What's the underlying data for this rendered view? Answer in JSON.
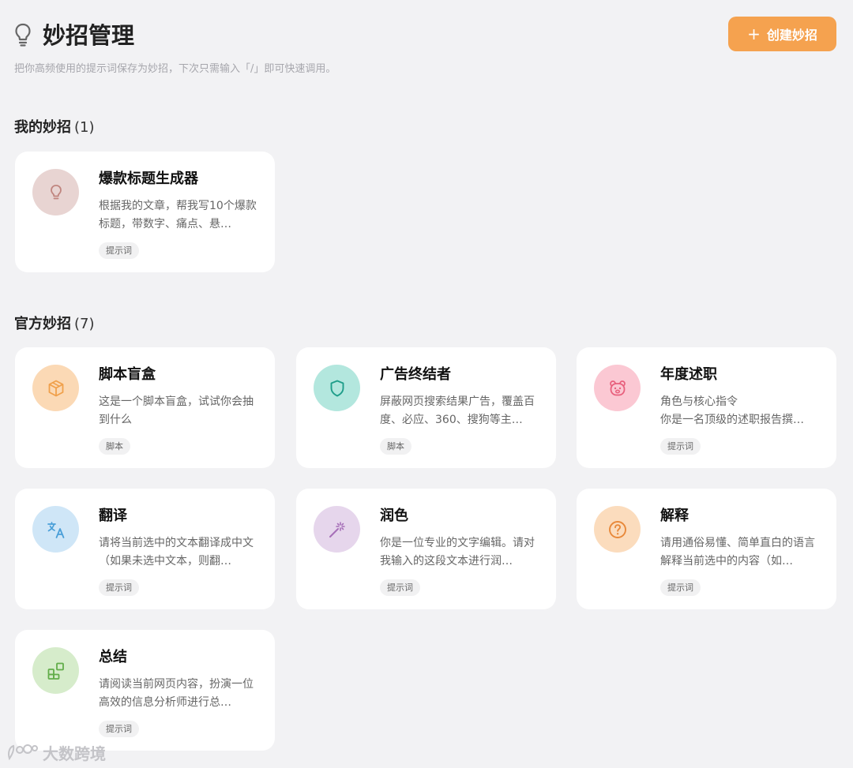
{
  "header": {
    "title": "妙招管理",
    "subtitle": "把你高频使用的提示词保存为妙招，下次只需输入「/」即可快速调用。",
    "create_button_label": "创建妙招",
    "create_button_icon": "plus-icon"
  },
  "my_section": {
    "title": "我的妙招",
    "count": "(1)",
    "cards": [
      {
        "title": "爆款标题生成器",
        "description": "根据我的文章，帮我写10个爆款标题，带数字、痛点、悬…",
        "tag": "提示词",
        "icon": "lightbulb-icon",
        "color": "#e8d4d2",
        "icon_color": "#c0857f"
      }
    ]
  },
  "official_section": {
    "title": "官方妙招",
    "count": "(7)",
    "cards": [
      {
        "title": "脚本盲盒",
        "description": "这是一个脚本盲盒，试试你会抽到什么",
        "tag": "脚本",
        "icon": "box-icon",
        "color": "#fbd9b5",
        "icon_color": "#f0a04b"
      },
      {
        "title": "广告终结者",
        "description": "屏蔽网页搜索结果广告，覆盖百度、必应、360、搜狗等主…",
        "tag": "脚本",
        "icon": "shield-icon",
        "color": "#b3e7de",
        "icon_color": "#1f9e8a"
      },
      {
        "title": "年度述职",
        "description": "角色与核心指令\n你是一名顶级的述职报告撰…",
        "tag": "提示词",
        "icon": "bear-icon",
        "color": "#fbc8d3",
        "icon_color": "#e8607d"
      },
      {
        "title": "翻译",
        "description": "请将当前选中的文本翻译成中文（如果未选中文本，则翻…",
        "tag": "提示词",
        "icon": "translate-icon",
        "color": "#cfe6f7",
        "icon_color": "#4a9fd8"
      },
      {
        "title": "润色",
        "description": "你是一位专业的文字编辑。请对我输入的这段文本进行润…",
        "tag": "提示词",
        "icon": "magic-wand-icon",
        "color": "#e6d6ec",
        "icon_color": "#a66fb8"
      },
      {
        "title": "解释",
        "description": "请用通俗易懂、简单直白的语言解释当前选中的内容（如…",
        "tag": "提示词",
        "icon": "question-icon",
        "color": "#fbdcbd",
        "icon_color": "#e8893a"
      },
      {
        "title": "总结",
        "description": "请阅读当前网页内容，扮演一位高效的信息分析师进行总…",
        "tag": "提示词",
        "icon": "grid-icon",
        "color": "#d6eccb",
        "icon_color": "#62ad4a"
      }
    ]
  },
  "watermark": {
    "text": "大数跨境",
    "icon": "logo-icon"
  }
}
